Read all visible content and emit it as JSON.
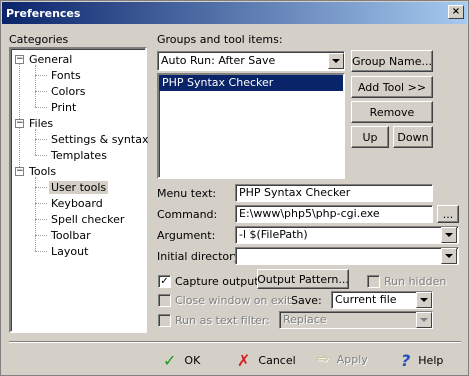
{
  "window": {
    "title": "Preferences",
    "close_glyph": "×"
  },
  "categories": {
    "heading": "Categories",
    "items": [
      {
        "label": "General",
        "children": [
          "Fonts",
          "Colors",
          "Print"
        ]
      },
      {
        "label": "Files",
        "children": [
          "Settings & syntax",
          "Templates"
        ]
      },
      {
        "label": "Tools",
        "children": [
          "User tools",
          "Keyboard",
          "Spell checker",
          "Toolbar",
          "Layout"
        ]
      }
    ],
    "selected": "User tools"
  },
  "groups": {
    "heading": "Groups and tool items:",
    "group_select": "Auto Run: After Save",
    "tool_items": [
      "PHP Syntax Checker"
    ],
    "selected_item": "PHP Syntax Checker"
  },
  "buttons": {
    "group_name": "Group Name...",
    "add_tool": "Add Tool >>",
    "remove": "Remove",
    "up": "Up",
    "down": "Down",
    "browse": "...",
    "output_pattern": "Output Pattern..."
  },
  "fields": {
    "menu_text_label": "Menu text:",
    "menu_text_value": "PHP Syntax Checker",
    "command_label": "Command:",
    "command_value": "E:\\www\\php5\\php-cgi.exe",
    "argument_label": "Argument:",
    "argument_value": "-l $(FilePath)",
    "initial_dir_label": "Initial directory:",
    "initial_dir_value": ""
  },
  "options": {
    "capture_output": "Capture output",
    "capture_checked": "✓",
    "run_hidden": "Run hidden",
    "close_window": "Close window on exit",
    "save_label": "Save:",
    "save_value": "Current file",
    "run_as_filter": "Run as text filter:",
    "filter_value": "Replace"
  },
  "footer": {
    "ok": "OK",
    "cancel": "Cancel",
    "apply": "Apply",
    "help": "Help"
  },
  "icons": {
    "ok": "✓",
    "cancel": "✗",
    "apply": "⇨",
    "help": "?"
  }
}
